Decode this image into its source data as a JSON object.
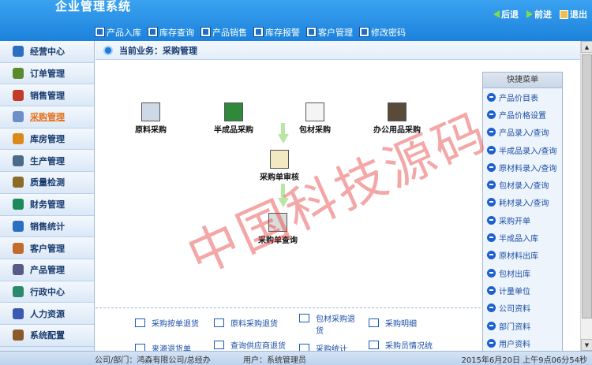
{
  "header": {
    "title": "企业管理系统",
    "nav": {
      "back": "后退",
      "forward": "前进",
      "exit": "退出"
    },
    "colors": {
      "header": "#2a92e6",
      "accent": "#e6701a"
    }
  },
  "menubar": [
    {
      "label": "产品入库",
      "icon": "doc-icon"
    },
    {
      "label": "库存查询",
      "icon": "search-icon"
    },
    {
      "label": "产品销售",
      "icon": "cart-icon"
    },
    {
      "label": "库存报警",
      "icon": "alarm-icon"
    },
    {
      "label": "客户管理",
      "icon": "customer-icon"
    },
    {
      "label": "修改密码",
      "icon": "key-icon"
    }
  ],
  "sidebar": {
    "items": [
      {
        "label": "经营中心",
        "icon": "globe-icon",
        "color": "#2b6fc2"
      },
      {
        "label": "订单管理",
        "icon": "order-icon",
        "color": "#5a8a2a"
      },
      {
        "label": "销售管理",
        "icon": "chart-icon",
        "color": "#c23b2b"
      },
      {
        "label": "采购管理",
        "icon": "users-icon",
        "color": "#6d8fc8",
        "active": true
      },
      {
        "label": "库房管理",
        "icon": "house-icon",
        "color": "#d98a1a"
      },
      {
        "label": "生产管理",
        "icon": "factory-icon",
        "color": "#4a6b8a"
      },
      {
        "label": "质量检测",
        "icon": "tools-icon",
        "color": "#8a6b2a"
      },
      {
        "label": "财务管理",
        "icon": "money-icon",
        "color": "#1a8a5a"
      },
      {
        "label": "销售统计",
        "icon": "stats-icon",
        "color": "#2a6fc2"
      },
      {
        "label": "客户管理",
        "icon": "customer-icon",
        "color": "#c26b2a"
      },
      {
        "label": "产品管理",
        "icon": "product-icon",
        "color": "#5a5a8a"
      },
      {
        "label": "行政中心",
        "icon": "phone-icon",
        "color": "#2a8a6b"
      },
      {
        "label": "人力资源",
        "icon": "people-icon",
        "color": "#3a5ab2"
      },
      {
        "label": "系统配置",
        "icon": "config-icon",
        "color": "#8a5a2a"
      }
    ]
  },
  "main": {
    "current_label": "当前业务：采购管理",
    "flow": {
      "raw": "原料采购",
      "semi": "半成品采购",
      "package": "包材采购",
      "office": "办公用品采购",
      "review": "采购单审核",
      "query": "采购单查询"
    },
    "links": [
      "采购按单退货",
      "原料采购退货",
      "包材采购退货",
      "采购明细",
      "来源退货单",
      "查询供应商退货",
      "采购统计",
      "采购员情况统"
    ]
  },
  "quick_menu": {
    "title": "快捷菜单",
    "items": [
      "产品价目表",
      "产品价格设置",
      "产品录入/查询",
      "半成品录入/查询",
      "原材料录入/查询",
      "包材录入/查询",
      "耗材录入/查询",
      "采购开单",
      "半成品入库",
      "原材料出库",
      "包材出库",
      "计量单位",
      "公司资料",
      "部门资料",
      "用户资料"
    ]
  },
  "status": {
    "company": "公司/部门：鸿森有限公司/总经办",
    "user": "用户：系统管理员",
    "datetime": "2015年6月20日 上午9点06分54秒"
  },
  "watermark": "中国科技源码"
}
